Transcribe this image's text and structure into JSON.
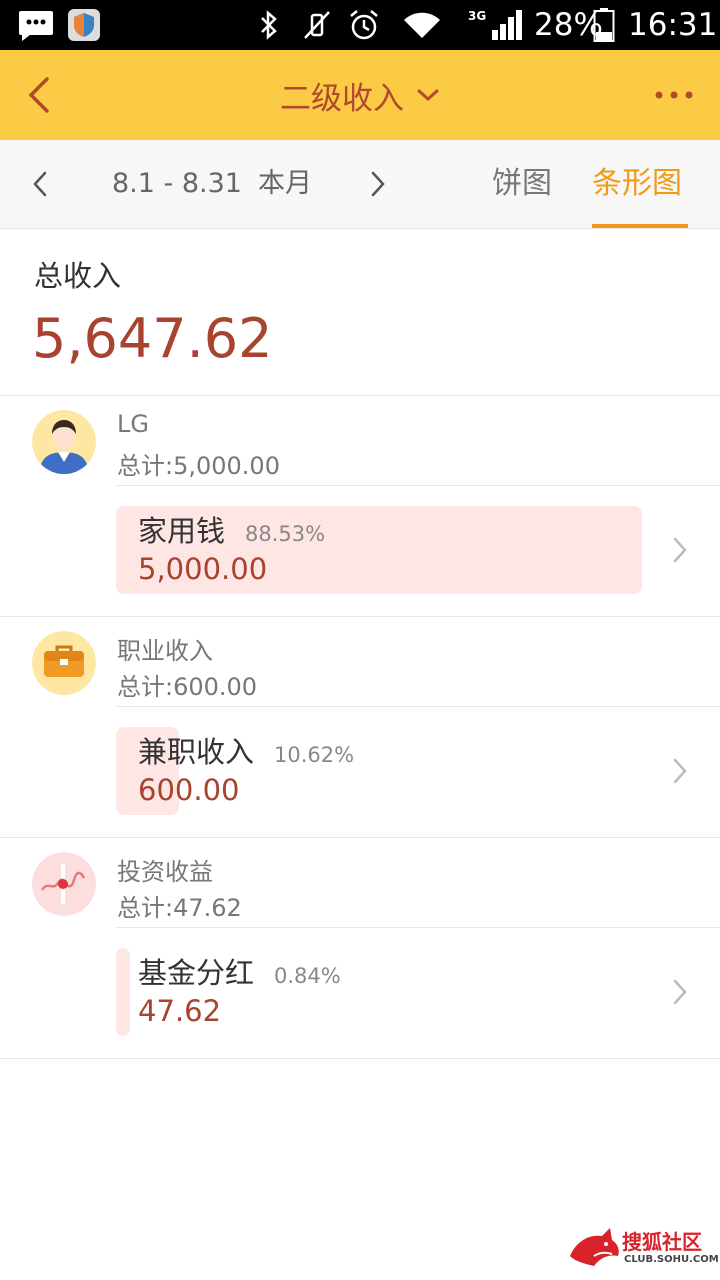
{
  "status_bar": {
    "network": "3G",
    "battery": "28%",
    "time": "16:31",
    "icons": [
      "message-icon",
      "shield-app-icon",
      "bluetooth-icon",
      "mute-icon",
      "alarm-icon",
      "wifi-icon",
      "signal-icon",
      "battery-icon"
    ]
  },
  "header": {
    "title": "二级收入",
    "icons": {
      "back": "back-arrow-icon",
      "dropdown": "chevron-down-icon",
      "more": "more-dots-icon"
    },
    "bg_color": "#fbcb45",
    "title_color": "#b0492d"
  },
  "toolbar": {
    "range": "8.1 - 8.31",
    "period": "本月",
    "tabs": [
      {
        "label": "饼图",
        "active": false
      },
      {
        "label": "条形图",
        "active": true
      }
    ],
    "active_color": "#f19a1a"
  },
  "summary": {
    "label": "总收入",
    "amount": "5,647.62",
    "amount_color": "#a7432e"
  },
  "groups": [
    {
      "name": "LG",
      "total": "总计:5,000.00",
      "avatar_icon": "person-avatar-icon",
      "items": [
        {
          "name": "家用钱",
          "percent": "88.53%",
          "share": 0.8853,
          "value": "5,000.00"
        }
      ]
    },
    {
      "name": "职业收入",
      "total": "总计:600.00",
      "avatar_icon": "briefcase-icon",
      "items": [
        {
          "name": "兼职收入",
          "percent": "10.62%",
          "share": 0.1062,
          "value": "600.00"
        }
      ]
    },
    {
      "name": "投资收益",
      "total": "总计:47.62",
      "avatar_icon": "stock-chart-icon",
      "items": [
        {
          "name": "基金分红",
          "percent": "0.84%",
          "share": 0.0084,
          "value": "47.62"
        }
      ]
    }
  ],
  "bar_color": "#fde6e4",
  "watermark": {
    "text": "搜狐社区",
    "sub": "CLUB.SOHU.COM",
    "icon": "sohu-fox-logo"
  }
}
